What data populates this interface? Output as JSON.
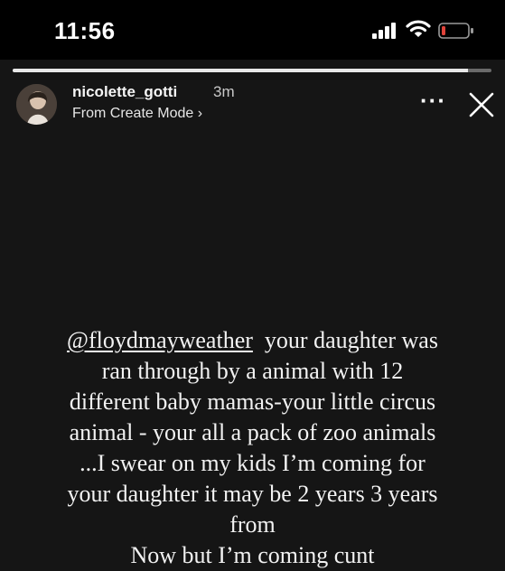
{
  "status_bar": {
    "time": "11:56",
    "icons": [
      "signal-icon",
      "wifi-icon",
      "battery-low-icon"
    ],
    "battery_color": "#e0433a"
  },
  "story": {
    "progress": 0.95,
    "username": "nicolette_gotti",
    "time_ago": "3m",
    "subtitle": "From Create Mode",
    "more_label": "···"
  },
  "caption": {
    "mention": "@floydmayweather",
    "line1_rest": "your daughter was",
    "lines": [
      "ran through by a animal with 12",
      "different baby mamas-your little circus",
      "animal - your all a pack of zoo animals",
      "...I swear on my kids I’m coming for",
      "your daughter it may be 2 years 3 years",
      "from",
      "Now but I’m coming cunt"
    ]
  }
}
